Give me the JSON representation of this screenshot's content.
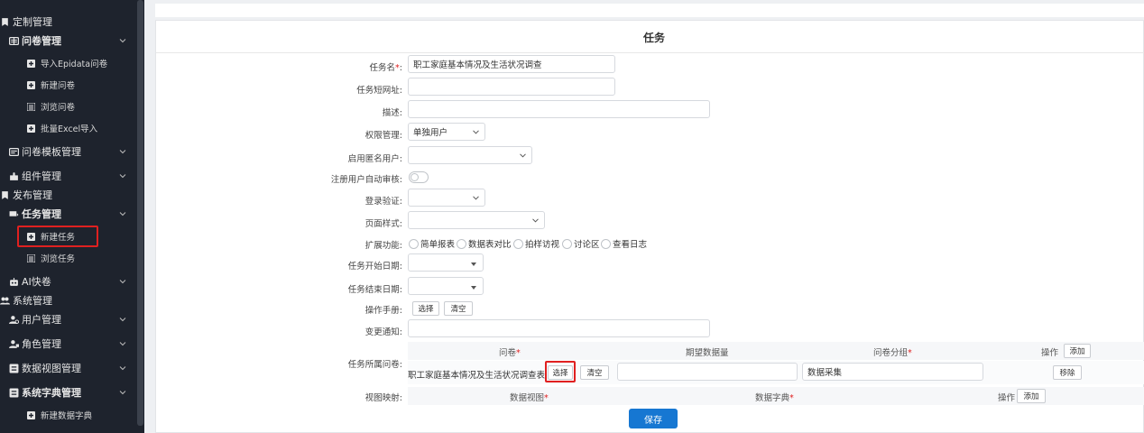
{
  "sidebar": {
    "sections": [
      {
        "label": "定制管理",
        "icon": "bookmark-icon"
      },
      {
        "label": "问卷管理",
        "icon": "form-icon"
      },
      {
        "label": "导入Epidata问卷",
        "icon": "plus-square-icon"
      },
      {
        "label": "新建问卷",
        "icon": "plus-square-icon"
      },
      {
        "label": "浏览问卷",
        "icon": "list-icon"
      },
      {
        "label": "批量Excel导入",
        "icon": "plus-square-icon"
      },
      {
        "label": "问卷模板管理",
        "icon": "template-icon"
      },
      {
        "label": "组件管理",
        "icon": "puzzle-icon"
      },
      {
        "label": "发布管理",
        "icon": "bookmark-icon"
      },
      {
        "label": "任务管理",
        "icon": "task-icon"
      },
      {
        "label": "新建任务",
        "icon": "plus-square-icon"
      },
      {
        "label": "浏览任务",
        "icon": "list-icon"
      },
      {
        "label": "AI快卷",
        "icon": "robot-icon"
      },
      {
        "label": "系统管理",
        "icon": "users-icon"
      },
      {
        "label": "用户管理",
        "icon": "user-gear-icon"
      },
      {
        "label": "角色管理",
        "icon": "role-icon"
      },
      {
        "label": "数据视图管理",
        "icon": "view-icon"
      },
      {
        "label": "系统字典管理",
        "icon": "dictionary-icon"
      },
      {
        "label": "新建数据字典",
        "icon": "plus-square-icon"
      }
    ]
  },
  "form": {
    "title": "任务",
    "task_name_label": "任务名",
    "task_name_value": "职工家庭基本情况及生活状况调查",
    "short_url_label": "任务短网址:",
    "description_label": "描述:",
    "permission_label": "权限管理:",
    "permission_value": "单独用户",
    "anonymous_label": "启用匿名用户:",
    "auto_review_label": "注册用户自动审核:",
    "login_verify_label": "登录验证:",
    "page_style_label": "页面样式:",
    "extensions_label": "扩展功能:",
    "extensions": [
      "简单报表",
      "数据表对比",
      "拍样访视",
      "讨论区",
      "查看日志"
    ],
    "start_date_label": "任务开始日期:",
    "end_date_label": "任务结束日期:",
    "operator_label": "操作手册:",
    "operator_select": "选择",
    "operator_clear": "清空",
    "change_notice_label": "变更通知:",
    "questionnaire_label": "任务所属问卷:",
    "col_questionnaire": "问卷",
    "col_expected": "期望数据量",
    "col_group": "问卷分组",
    "col_action": "操作",
    "add_label": "添加",
    "row_questionnaire": "职工家庭基本情况及生活状况调查表",
    "row_select": "选择",
    "row_clear": "清空",
    "row_group_value": "数据采集",
    "row_remove": "移除",
    "view_mapping_label": "视图映射:",
    "col_data_view": "数据视图",
    "col_data_dict": "数据字典",
    "col_action2": "操作",
    "add2_label": "添加",
    "save_label": "保存"
  }
}
